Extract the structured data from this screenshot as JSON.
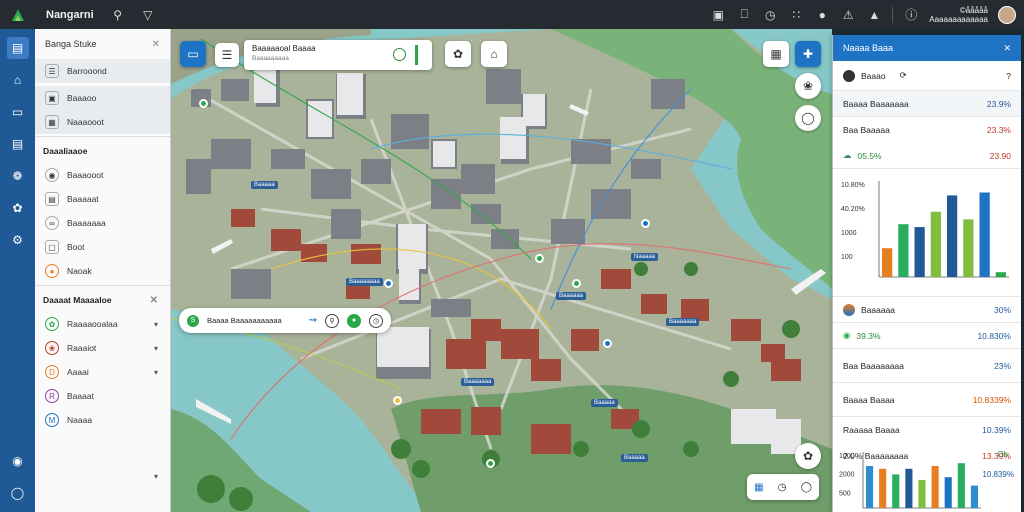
{
  "app": {
    "title": "Nangarni"
  },
  "user": {
    "line1": "©ååååå",
    "line2": "Aaaaaaaaaaaaa"
  },
  "left_panel": {
    "title": "Banga Stuke",
    "group1": [
      {
        "label": "Barrooond",
        "icon": "layers-icon"
      },
      {
        "label": "Baaaoo",
        "icon": "image-icon"
      },
      {
        "label": "Naaaooot",
        "icon": "map-icon"
      }
    ],
    "section2": "Daaaliaaoe",
    "group2": [
      {
        "label": "Baaaooot",
        "icon": "globe-icon"
      },
      {
        "label": "Baaaaat",
        "icon": "doc-icon"
      },
      {
        "label": "Baaaaaaa",
        "icon": "link-icon"
      },
      {
        "label": "Boot",
        "icon": "square-icon"
      },
      {
        "label": "Naoak",
        "icon": "pin-icon"
      }
    ],
    "section3": "Daaaat Maaaaloe",
    "group3": [
      {
        "label": "Raaaaooalaa",
        "icon": "leaf-icon"
      },
      {
        "label": "Raaaiot",
        "icon": "flower-icon"
      },
      {
        "label": "Aaaai",
        "icon": "d-icon"
      },
      {
        "label": "Baaaat",
        "icon": "r-icon"
      },
      {
        "label": "Naaaa",
        "icon": "m-icon"
      }
    ]
  },
  "map": {
    "search_title": "Baaaaaoal Baaaa",
    "search_sub": "Baaaaaaaaa",
    "route_text": "Baaaa Baaaaaaaaaaa",
    "labels": [
      "Baaaaa",
      "Baaaaaaaa",
      "Naaaaa",
      "Baaaaaa",
      "Baaaaaaa",
      "Baaaaaaa",
      "Baaaaa",
      "Baaaaa"
    ]
  },
  "right_panel": {
    "title": "Naaaa Baaa",
    "row1_label": "Baaao",
    "row2_label": "Baaaa Baaaaaaa",
    "row2_val": "23.9%",
    "row3_label": "Baa Baaaaa",
    "row3_val": "23.3%",
    "row4_label": "05.5%",
    "row4_val": "23.90",
    "row5_label": "Baaaaaa",
    "row5_val": "30%",
    "row6_label": "39.3%",
    "row6_val": "10.830%",
    "row7_label": "Baa Baaaaaaaa",
    "row7_val": "23%",
    "row8_label": "Baaaa Baaaa",
    "row8_val": "10.8339%",
    "row9_label": "Raaaaa Baaaa",
    "row9_val": "10.39%",
    "row10_label": "2.0% Baaaaaaaa",
    "row10_val": "13.39%",
    "chart_note": "Oh",
    "chart_tail": "10.839%"
  },
  "chart_data": [
    {
      "type": "bar",
      "yticks": [
        "10.80%",
        "40.20%",
        "1000",
        "100"
      ],
      "values": [
        30,
        55,
        52,
        68,
        85,
        60,
        88,
        5
      ],
      "colors": [
        "#e67e22",
        "#27ae60",
        "#1f5a96",
        "#7fbf3f",
        "#1f5a96",
        "#7fbf3f",
        "#1f73c4",
        "#2aa84a"
      ]
    },
    {
      "type": "bar",
      "yticks": [
        "1000",
        "2000",
        "500"
      ],
      "values": [
        75,
        70,
        60,
        70,
        50,
        75,
        55,
        80,
        40
      ],
      "colors": [
        "#2a8ed0",
        "#e67e22",
        "#27ae60",
        "#1f5a96",
        "#7fbf3f",
        "#e67e22",
        "#1f73c4",
        "#27ae60",
        "#2a8ed0"
      ]
    }
  ]
}
